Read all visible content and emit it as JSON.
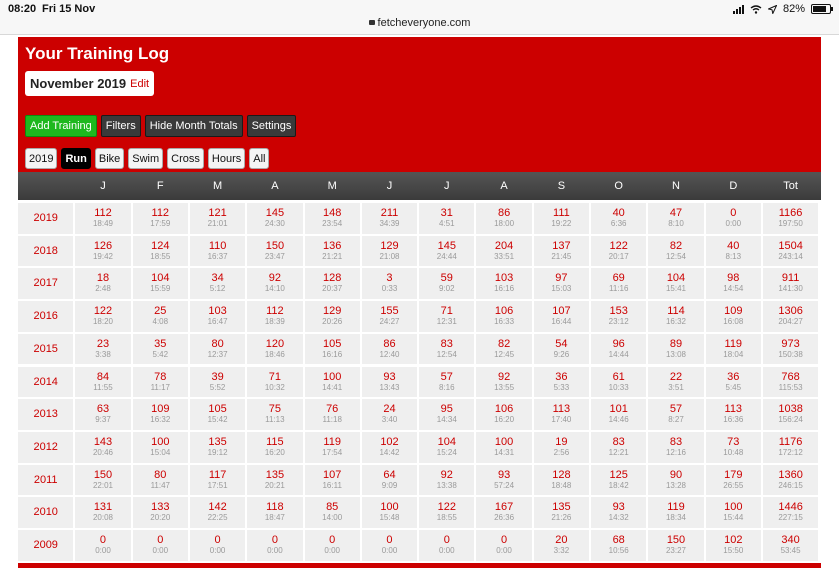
{
  "status_bar": {
    "time": "08:20",
    "date": "Fri 15 Nov",
    "url": "fetcheveryone.com",
    "battery": "82%",
    "battery_level": 0.82
  },
  "page": {
    "title": "Your Training Log",
    "month_label": "November 2019",
    "edit_label": "Edit"
  },
  "actions": [
    {
      "label": "Add Training",
      "style": "green"
    },
    {
      "label": "Filters",
      "style": "dark"
    },
    {
      "label": "Hide Month Totals",
      "style": "dark"
    },
    {
      "label": "Settings",
      "style": "dark"
    }
  ],
  "filters": [
    {
      "label": "2019",
      "active": false
    },
    {
      "label": "Run",
      "active": true
    },
    {
      "label": "Bike",
      "active": false
    },
    {
      "label": "Swim",
      "active": false
    },
    {
      "label": "Cross",
      "active": false
    },
    {
      "label": "Hours",
      "active": false
    },
    {
      "label": "All",
      "active": false
    }
  ],
  "colors": {
    "brand_red": "#cc0000",
    "active_green": "#1eb81e"
  },
  "table": {
    "headers": [
      "",
      "J",
      "F",
      "M",
      "A",
      "M",
      "J",
      "J",
      "A",
      "S",
      "O",
      "N",
      "D",
      "Tot"
    ],
    "rows": [
      {
        "year": "2019",
        "cells": [
          [
            "112",
            "18:49"
          ],
          [
            "112",
            "17:59"
          ],
          [
            "121",
            "21:01"
          ],
          [
            "145",
            "24:30"
          ],
          [
            "148",
            "23:54"
          ],
          [
            "211",
            "34:39"
          ],
          [
            "31",
            "4:51"
          ],
          [
            "86",
            "18:00"
          ],
          [
            "111",
            "19:22"
          ],
          [
            "40",
            "6:36"
          ],
          [
            "47",
            "8:10"
          ],
          [
            "0",
            "0:00"
          ],
          [
            "1166",
            "197:50"
          ]
        ]
      },
      {
        "year": "2018",
        "cells": [
          [
            "126",
            "19:42"
          ],
          [
            "124",
            "18:55"
          ],
          [
            "110",
            "16:37"
          ],
          [
            "150",
            "23:47"
          ],
          [
            "136",
            "21:21"
          ],
          [
            "129",
            "21:08"
          ],
          [
            "145",
            "24:44"
          ],
          [
            "204",
            "33:51"
          ],
          [
            "137",
            "21:45"
          ],
          [
            "122",
            "20:17"
          ],
          [
            "82",
            "12:54"
          ],
          [
            "40",
            "8:13"
          ],
          [
            "1504",
            "243:14"
          ]
        ]
      },
      {
        "year": "2017",
        "cells": [
          [
            "18",
            "2:48"
          ],
          [
            "104",
            "15:59"
          ],
          [
            "34",
            "5:12"
          ],
          [
            "92",
            "14:10"
          ],
          [
            "128",
            "20:37"
          ],
          [
            "3",
            "0:33"
          ],
          [
            "59",
            "9:02"
          ],
          [
            "103",
            "16:16"
          ],
          [
            "97",
            "15:03"
          ],
          [
            "69",
            "11:16"
          ],
          [
            "104",
            "15:41"
          ],
          [
            "98",
            "14:54"
          ],
          [
            "911",
            "141:30"
          ]
        ]
      },
      {
        "year": "2016",
        "cells": [
          [
            "122",
            "18:20"
          ],
          [
            "25",
            "4:08"
          ],
          [
            "103",
            "16:47"
          ],
          [
            "112",
            "18:39"
          ],
          [
            "129",
            "20:26"
          ],
          [
            "155",
            "24:27"
          ],
          [
            "71",
            "12:31"
          ],
          [
            "106",
            "16:33"
          ],
          [
            "107",
            "16:44"
          ],
          [
            "153",
            "23:12"
          ],
          [
            "114",
            "16:32"
          ],
          [
            "109",
            "16:08"
          ],
          [
            "1306",
            "204:27"
          ]
        ]
      },
      {
        "year": "2015",
        "cells": [
          [
            "23",
            "3:38"
          ],
          [
            "35",
            "5:42"
          ],
          [
            "80",
            "12:37"
          ],
          [
            "120",
            "18:46"
          ],
          [
            "105",
            "16:16"
          ],
          [
            "86",
            "12:40"
          ],
          [
            "83",
            "12:54"
          ],
          [
            "82",
            "12:45"
          ],
          [
            "54",
            "9:26"
          ],
          [
            "96",
            "14:44"
          ],
          [
            "89",
            "13:08"
          ],
          [
            "119",
            "18:04"
          ],
          [
            "973",
            "150:38"
          ]
        ]
      },
      {
        "year": "2014",
        "cells": [
          [
            "84",
            "11:55"
          ],
          [
            "78",
            "11:17"
          ],
          [
            "39",
            "5:52"
          ],
          [
            "71",
            "10:32"
          ],
          [
            "100",
            "14:41"
          ],
          [
            "93",
            "13:43"
          ],
          [
            "57",
            "8:16"
          ],
          [
            "92",
            "13:55"
          ],
          [
            "36",
            "5:33"
          ],
          [
            "61",
            "10:33"
          ],
          [
            "22",
            "3:51"
          ],
          [
            "36",
            "5:45"
          ],
          [
            "768",
            "115:53"
          ]
        ]
      },
      {
        "year": "2013",
        "cells": [
          [
            "63",
            "9:37"
          ],
          [
            "109",
            "16:32"
          ],
          [
            "105",
            "15:42"
          ],
          [
            "75",
            "11:13"
          ],
          [
            "76",
            "11:18"
          ],
          [
            "24",
            "3:40"
          ],
          [
            "95",
            "14:34"
          ],
          [
            "106",
            "16:20"
          ],
          [
            "113",
            "17:40"
          ],
          [
            "101",
            "14:46"
          ],
          [
            "57",
            "8:27"
          ],
          [
            "113",
            "16:36"
          ],
          [
            "1038",
            "156:24"
          ]
        ]
      },
      {
        "year": "2012",
        "cells": [
          [
            "143",
            "20:46"
          ],
          [
            "100",
            "15:04"
          ],
          [
            "135",
            "19:12"
          ],
          [
            "115",
            "16:20"
          ],
          [
            "119",
            "17:54"
          ],
          [
            "102",
            "14:42"
          ],
          [
            "104",
            "15:24"
          ],
          [
            "100",
            "14:31"
          ],
          [
            "19",
            "2:56"
          ],
          [
            "83",
            "12:21"
          ],
          [
            "83",
            "12:16"
          ],
          [
            "73",
            "10:48"
          ],
          [
            "1176",
            "172:12"
          ]
        ]
      },
      {
        "year": "2011",
        "cells": [
          [
            "150",
            "22:01"
          ],
          [
            "80",
            "11:47"
          ],
          [
            "117",
            "17:51"
          ],
          [
            "135",
            "20:21"
          ],
          [
            "107",
            "16:11"
          ],
          [
            "64",
            "9:09"
          ],
          [
            "92",
            "13:38"
          ],
          [
            "93",
            "57:24"
          ],
          [
            "128",
            "18:48"
          ],
          [
            "125",
            "18:42"
          ],
          [
            "90",
            "13:28"
          ],
          [
            "179",
            "26:55"
          ],
          [
            "1360",
            "246:15"
          ]
        ]
      },
      {
        "year": "2010",
        "cells": [
          [
            "131",
            "20:08"
          ],
          [
            "133",
            "20:20"
          ],
          [
            "142",
            "22:25"
          ],
          [
            "118",
            "18:47"
          ],
          [
            "85",
            "14:00"
          ],
          [
            "100",
            "15:48"
          ],
          [
            "122",
            "18:55"
          ],
          [
            "167",
            "26:36"
          ],
          [
            "135",
            "21:26"
          ],
          [
            "93",
            "14:32"
          ],
          [
            "119",
            "18:34"
          ],
          [
            "100",
            "15:44"
          ],
          [
            "1446",
            "227:15"
          ]
        ]
      },
      {
        "year": "2009",
        "cells": [
          [
            "0",
            "0:00"
          ],
          [
            "0",
            "0:00"
          ],
          [
            "0",
            "0:00"
          ],
          [
            "0",
            "0:00"
          ],
          [
            "0",
            "0:00"
          ],
          [
            "0",
            "0:00"
          ],
          [
            "0",
            "0:00"
          ],
          [
            "0",
            "0:00"
          ],
          [
            "20",
            "3:32"
          ],
          [
            "68",
            "10:56"
          ],
          [
            "150",
            "23:27"
          ],
          [
            "102",
            "15:50"
          ],
          [
            "340",
            "53:45"
          ]
        ]
      }
    ]
  }
}
